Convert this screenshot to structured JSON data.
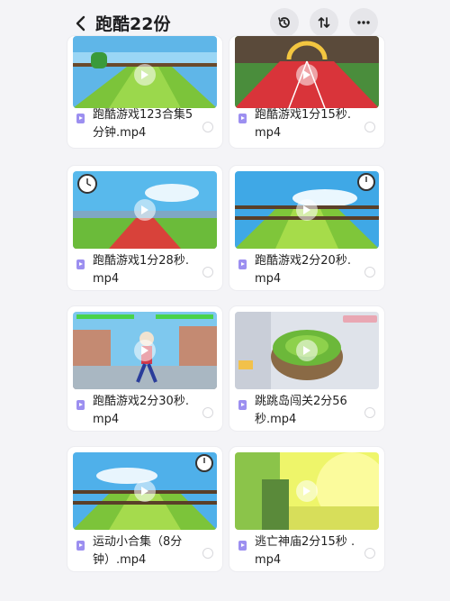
{
  "header": {
    "title": "跑酷22份",
    "icons": [
      "back-arrow-icon",
      "history-icon",
      "sort-icon",
      "more-icon"
    ]
  },
  "files": [
    {
      "name": "跑酷游戏123合集5分钟.mp4",
      "scene": "green-track-sky"
    },
    {
      "name": "跑酷游戏1分15秒.mp4",
      "scene": "red-track-arch"
    },
    {
      "name": "跑酷游戏1分28秒.mp4",
      "scene": "red-track-clock"
    },
    {
      "name": "跑酷游戏2分20秒.mp4",
      "scene": "green-track-clock"
    },
    {
      "name": "跑酷游戏2分30秒.mp4",
      "scene": "fighter-rooftop"
    },
    {
      "name": "跳跳岛闯关2分56秒.mp4",
      "scene": "island-platform"
    },
    {
      "name": "运动小合集（8分钟）.mp4",
      "scene": "green-track-clock"
    },
    {
      "name": "逃亡神庙2分15秒 .mp4",
      "scene": "yellow-temple"
    }
  ],
  "colors": {
    "background": "#f4f4f7",
    "card": "#ffffff",
    "file_icon": "#9c8ff0"
  }
}
